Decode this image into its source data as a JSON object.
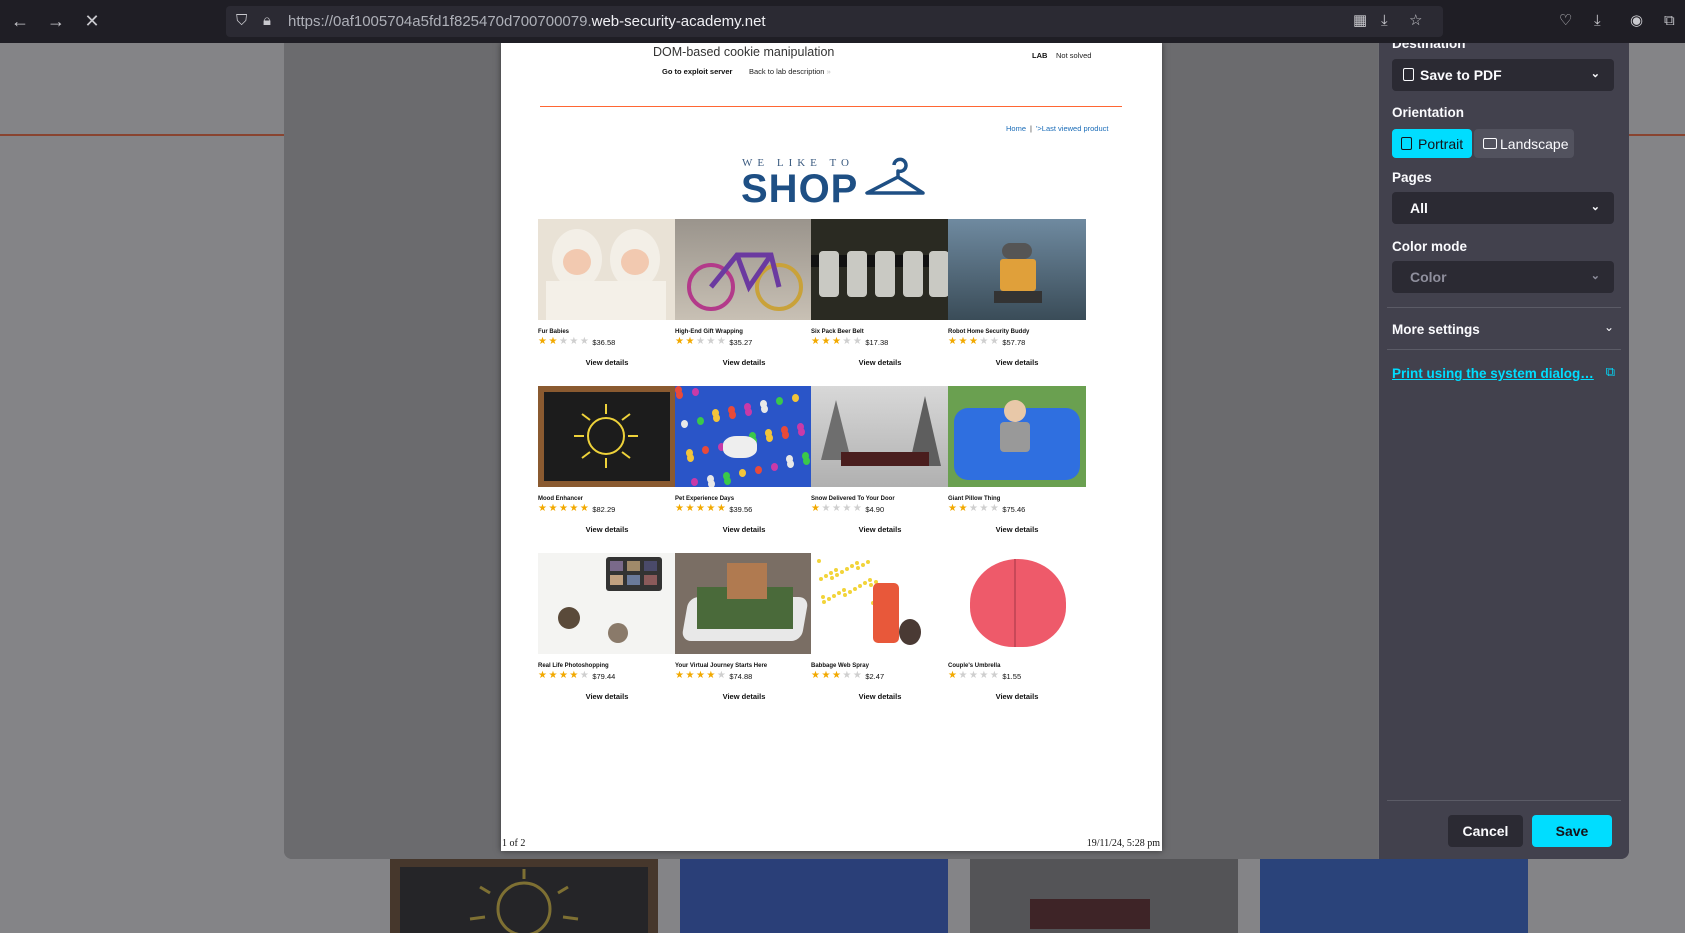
{
  "browser": {
    "url_prefix": "https://0af1005704a5fd1f825470d700700079.",
    "url_domain": "web-security-academy.net"
  },
  "print_dialog": {
    "destination_label": "Destination",
    "destination_value": "Save to PDF",
    "orientation_label": "Orientation",
    "portrait_label": "Portrait",
    "landscape_label": "Landscape",
    "orientation_selected": "Portrait",
    "pages_label": "Pages",
    "pages_value": "All",
    "color_mode_label": "Color mode",
    "color_mode_value": "Color",
    "more_settings_label": "More settings",
    "system_dialog_link": "Print using the system dialog…",
    "cancel_label": "Cancel",
    "save_label": "Save",
    "accent_color": "#00ddff"
  },
  "preview": {
    "lab_title": "DOM-based cookie manipulation",
    "exploit_link": "Go to exploit server",
    "back_link": "Back to lab description",
    "lab_badge": "LAB",
    "lab_status": "Not solved",
    "nav_home": "Home",
    "nav_sep": "|",
    "nav_last": "'>Last viewed product",
    "logo_small": "WE LIKE TO",
    "logo_big": "SHOP",
    "view_label": "View details",
    "footer_page": "1 of 2",
    "footer_date": "19/11/24, 5:28 pm",
    "products": [
      {
        "name": "Fur Babies",
        "rating": 2,
        "price": "$36.58",
        "image": "babies"
      },
      {
        "name": "High-End Gift Wrapping",
        "rating": 2,
        "price": "$35.27",
        "image": "bicycle"
      },
      {
        "name": "Six Pack Beer Belt",
        "rating": 3,
        "price": "$17.38",
        "image": "beerbelt"
      },
      {
        "name": "Robot Home Security Buddy",
        "rating": 3,
        "price": "$57.78",
        "image": "robot"
      },
      {
        "name": "Mood Enhancer",
        "rating": 5,
        "price": "$82.29",
        "image": "sun-chalkboard"
      },
      {
        "name": "Pet Experience Days",
        "rating": 5,
        "price": "$39.56",
        "image": "balloons-dog"
      },
      {
        "name": "Snow Delivered To Your Door",
        "rating": 1,
        "price": "$4.90",
        "image": "snow-train"
      },
      {
        "name": "Giant Pillow Thing",
        "rating": 2,
        "price": "$75.46",
        "image": "blue-pillow"
      },
      {
        "name": "Real Life Photoshopping",
        "rating": 4,
        "price": "$79.44",
        "image": "makeup"
      },
      {
        "name": "Your Virtual Journey Starts Here",
        "rating": 4,
        "price": "$74.88",
        "image": "phone-castle"
      },
      {
        "name": "Babbage Web Spray",
        "rating": 3,
        "price": "$2.47",
        "image": "spray-can"
      },
      {
        "name": "Couple's Umbrella",
        "rating": 1,
        "price": "$1.55",
        "image": "umbrella"
      }
    ]
  }
}
